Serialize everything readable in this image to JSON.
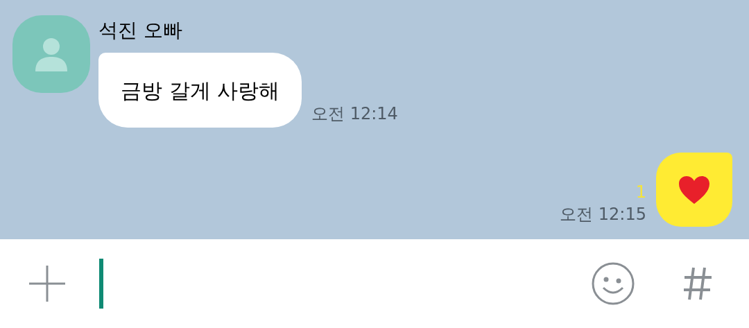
{
  "messages": [
    {
      "kind": "incoming",
      "sender": "석진 오빠",
      "body": {
        "kind": "text",
        "text": "금방 갈게 사랑해"
      },
      "time": "오전 12:14"
    },
    {
      "kind": "outgoing",
      "body": {
        "kind": "heart"
      },
      "unread": "1",
      "time": "오전 12:15"
    }
  ]
}
